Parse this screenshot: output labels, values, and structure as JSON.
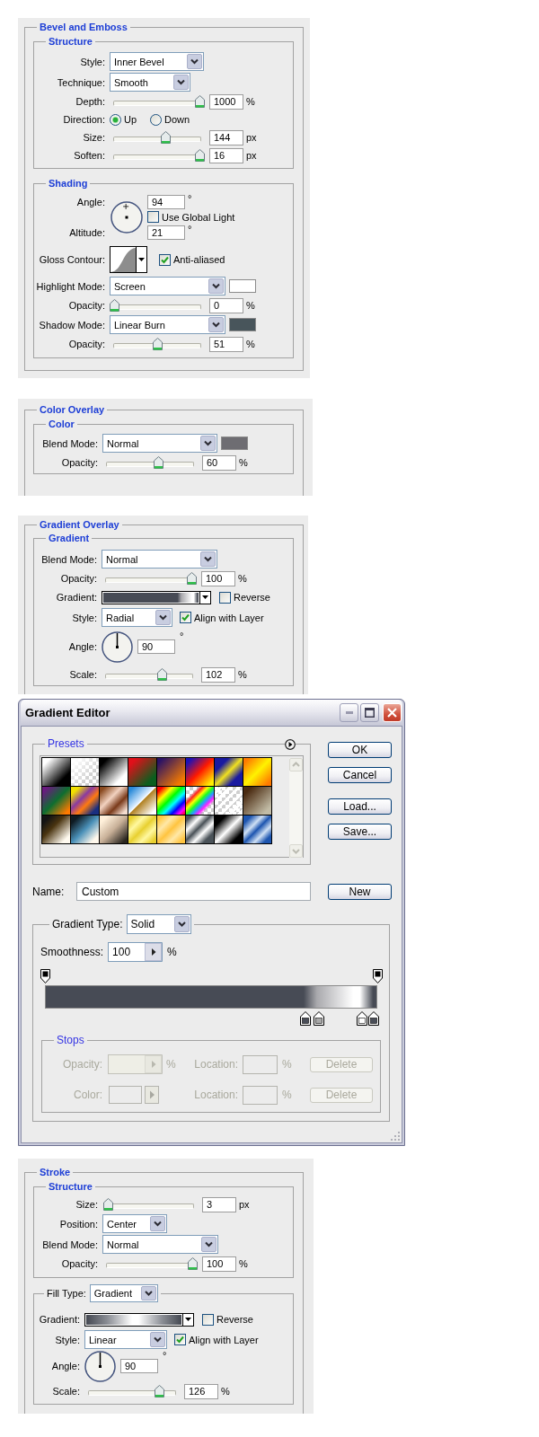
{
  "bevel_and_emboss": {
    "title": "Bevel and Emboss",
    "sections": [
      {
        "title": "Structure",
        "rows": [
          {
            "kind": "select",
            "label": "Style:",
            "value": "Inner Bevel"
          },
          {
            "kind": "select",
            "label": "Technique:",
            "value": "Smooth"
          },
          {
            "kind": "slider",
            "label": "Depth:",
            "level": 1,
            "value": "1000",
            "unit": "%"
          },
          {
            "kind": "radio",
            "label": "Direction:",
            "options": [
              {
                "label": "Up",
                "selected": true
              },
              {
                "label": "Down",
                "selected": false
              }
            ]
          },
          {
            "kind": "slider",
            "label": "Size:",
            "level": 0.6,
            "value": "144",
            "unit": "px"
          },
          {
            "kind": "slider",
            "label": "Soften:",
            "level": 1,
            "value": "16",
            "unit": "px"
          }
        ]
      },
      {
        "title": "Shading",
        "rows": [
          {
            "kind": "light",
            "angle": {
              "label": "Angle:",
              "value": "94",
              "unit": "°"
            },
            "global_light": {
              "label": "Use Global Light",
              "checked": false
            },
            "altitude": {
              "label": "Altitude:",
              "value": "21",
              "unit": "°"
            }
          },
          {
            "kind": "contour",
            "label": "Gloss Contour:",
            "checkbox": {
              "label": "Anti-aliased",
              "checked": true
            }
          },
          {
            "kind": "select",
            "label": "Highlight Mode:",
            "value": "Screen",
            "color": "#ffffff"
          },
          {
            "kind": "slider",
            "label": "Opacity:",
            "level": 0,
            "value": "0",
            "unit": "%"
          },
          {
            "kind": "select",
            "label": "Shadow Mode:",
            "value": "Linear Burn",
            "color": "#48555b"
          },
          {
            "kind": "slider",
            "label": "Opacity:",
            "level": 0.51,
            "value": "51",
            "unit": "%"
          }
        ]
      }
    ]
  },
  "color_overlay": {
    "title": "Color Overlay",
    "sections": [
      {
        "title": "Color",
        "rows": [
          {
            "kind": "select",
            "label": "Blend Mode:",
            "value": "Normal",
            "color": "#6e6d72"
          },
          {
            "kind": "slider",
            "label": "Opacity:",
            "level": 0.6,
            "value": "60",
            "unit": "%"
          }
        ]
      }
    ]
  },
  "gradient_overlay": {
    "title": "Gradient Overlay",
    "sections": [
      {
        "title": "Gradient",
        "rows": [
          {
            "kind": "select",
            "label": "Blend Mode:",
            "value": "Normal"
          },
          {
            "kind": "slider",
            "label": "Opacity:",
            "level": 1,
            "value": "100",
            "unit": "%"
          },
          {
            "kind": "gradient",
            "label": "Gradient:",
            "checkbox": {
              "label": "Reverse",
              "checked": false
            }
          },
          {
            "kind": "select",
            "label": "Style:",
            "value": "Radial",
            "checkbox": {
              "label": "Align with Layer",
              "checked": true
            }
          },
          {
            "kind": "angle",
            "label": "Angle:",
            "value": "90",
            "unit": "°"
          },
          {
            "kind": "slider",
            "label": "Scale:",
            "level": 0.65,
            "value": "102",
            "unit": "%"
          }
        ]
      }
    ]
  },
  "gradient_editor": {
    "title": "Gradient Editor",
    "presets": {
      "title": "Presets"
    },
    "buttons": [
      "OK",
      "Cancel",
      "Load...",
      "Save..."
    ],
    "name": {
      "label": "Name:",
      "value": "Custom"
    },
    "new_button": "New",
    "gradient_type": {
      "label": "Gradient Type:",
      "value": "Solid"
    },
    "smoothness": {
      "label": "Smoothness:",
      "value": "100",
      "unit": "%"
    },
    "stops": {
      "title": "Stops",
      "rows": [
        {
          "kind": "opacity",
          "label": "Opacity:",
          "unit": "%",
          "location_label": "Location:",
          "location_unit": "%",
          "button": "Delete",
          "disabled": true
        },
        {
          "kind": "color",
          "label": "Color:",
          "location_label": "Location:",
          "location_unit": "%",
          "button": "Delete",
          "disabled": true
        }
      ]
    }
  },
  "stroke": {
    "title": "Stroke",
    "sections": [
      {
        "title": "Structure",
        "rows": [
          {
            "kind": "slider",
            "label": "Size:",
            "level": 0.01,
            "value": "3",
            "unit": "px"
          },
          {
            "kind": "select",
            "label": "Position:",
            "value": "Center"
          },
          {
            "kind": "select",
            "label": "Blend Mode:",
            "value": "Normal"
          },
          {
            "kind": "slider",
            "label": "Opacity:",
            "level": 1,
            "value": "100",
            "unit": "%"
          }
        ]
      },
      {
        "legend_select": {
          "label": "Fill Type:",
          "value": "Gradient"
        },
        "rows": [
          {
            "kind": "gradient",
            "label": "Gradient:",
            "checkbox": {
              "label": "Reverse",
              "checked": false
            }
          },
          {
            "kind": "select",
            "label": "Style:",
            "value": "Linear",
            "checkbox": {
              "label": "Align with Layer",
              "checked": true
            }
          },
          {
            "kind": "angle",
            "label": "Angle:",
            "value": "90",
            "unit": "°"
          },
          {
            "kind": "slider",
            "label": "Scale:",
            "level": 0.82,
            "value": "126",
            "unit": "%"
          }
        ]
      }
    ]
  }
}
